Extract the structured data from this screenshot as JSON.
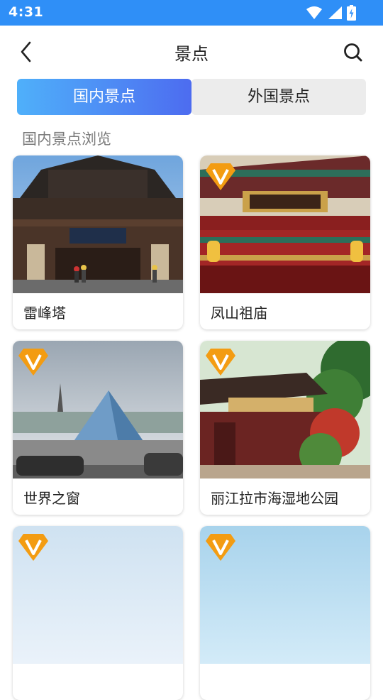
{
  "status_bar": {
    "time": "4:31",
    "icons": [
      "wifi-icon",
      "signal-icon",
      "battery-icon"
    ]
  },
  "header": {
    "title": "景点",
    "back_icon": "chevron-left-icon",
    "search_icon": "search-icon"
  },
  "tabs": [
    {
      "label": "国内景点",
      "active": true
    },
    {
      "label": "外国景点",
      "active": false
    }
  ],
  "section": {
    "title": "国内景点浏览"
  },
  "attractions": [
    {
      "name": "雷峰塔",
      "vip": false
    },
    {
      "name": "凤山祖庙",
      "vip": true
    },
    {
      "name": "世界之窗",
      "vip": true
    },
    {
      "name": "丽江拉市海湿地公园",
      "vip": true
    },
    {
      "name": "",
      "vip": true
    },
    {
      "name": "",
      "vip": true
    }
  ],
  "colors": {
    "status_bar": "#2F8FF7",
    "tab_gradient_start": "#4FB0FA",
    "tab_gradient_end": "#4D6CF0",
    "badge": "#F39C12"
  }
}
